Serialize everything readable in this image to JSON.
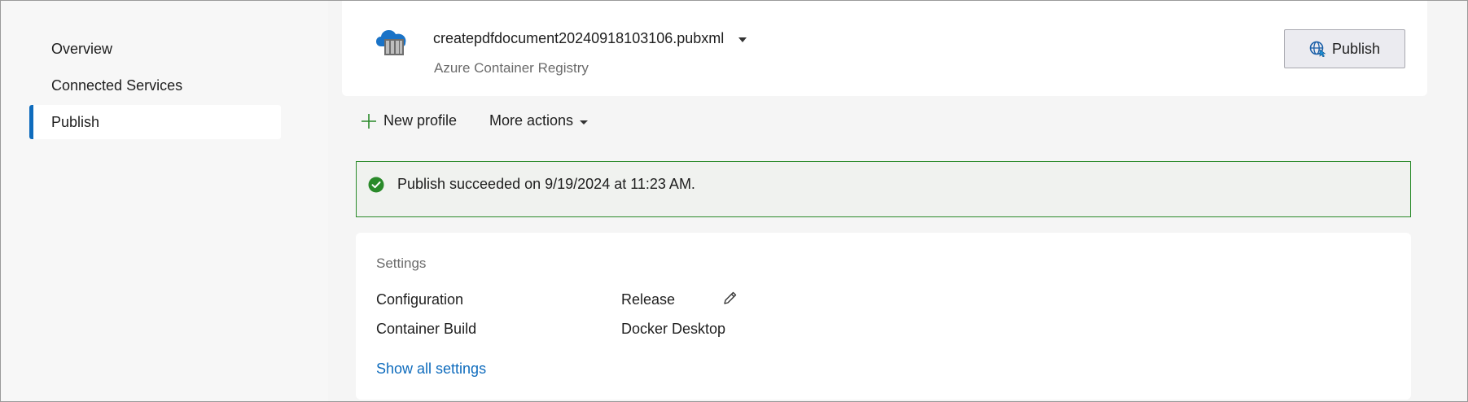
{
  "sidebar": {
    "items": [
      {
        "label": "Overview"
      },
      {
        "label": "Connected Services"
      },
      {
        "label": "Publish",
        "selected": true
      }
    ]
  },
  "profile": {
    "name": "createpdfdocument20240918103106.pubxml",
    "target": "Azure Container Registry",
    "icon": "cloud-container-icon"
  },
  "publish_button": {
    "label": "Publish",
    "icon": "globe-publish-icon"
  },
  "actions": {
    "new_profile_label": "New profile",
    "more_actions_label": "More actions"
  },
  "status": {
    "message": "Publish succeeded on 9/19/2024 at 11:23 AM.",
    "icon": "success-check-icon",
    "color": "#2a8a2a"
  },
  "settings": {
    "title": "Settings",
    "rows": [
      {
        "label": "Configuration",
        "value": "Release"
      },
      {
        "label": "Container Build",
        "value": "Docker Desktop"
      }
    ],
    "show_all_label": "Show all settings"
  },
  "colors": {
    "accent": "#0f6cbd",
    "success": "#2a8a2a"
  }
}
